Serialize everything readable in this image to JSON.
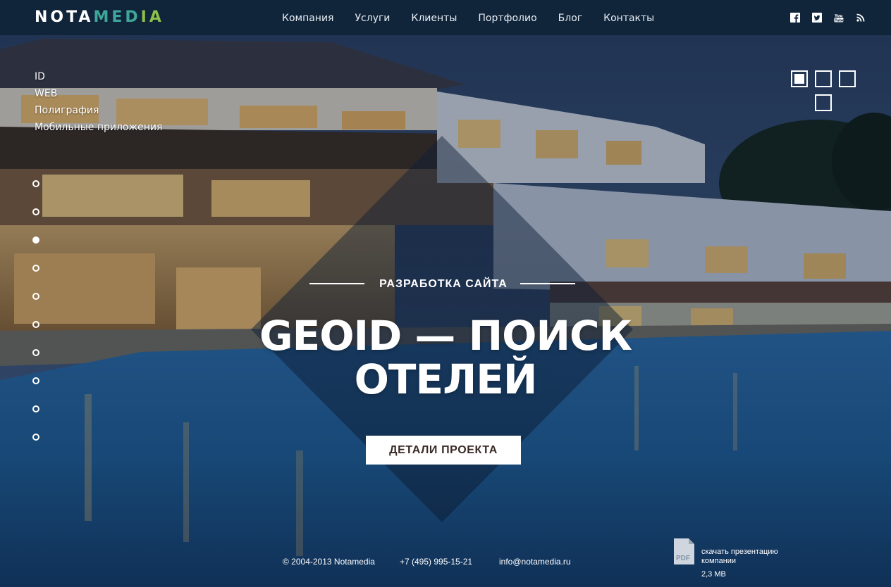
{
  "header": {
    "logo": {
      "part1": "NOTA",
      "part2_a": "MED",
      "part2_b": "IA"
    },
    "nav": [
      {
        "label": "Компания"
      },
      {
        "label": "Услуги"
      },
      {
        "label": "Клиенты"
      },
      {
        "label": "Портфолио"
      },
      {
        "label": "Блог"
      },
      {
        "label": "Контакты"
      }
    ],
    "social": [
      "facebook-icon",
      "twitter-icon",
      "youtube-icon",
      "rss-icon"
    ]
  },
  "categories": [
    {
      "label": "ID"
    },
    {
      "label": "WEB"
    },
    {
      "label": "Полиграфия"
    },
    {
      "label": "Мобильные приложения"
    }
  ],
  "slider": {
    "total_dots": 10,
    "active_dot": 3
  },
  "view_switch": {
    "active": 1,
    "count": 4
  },
  "hero": {
    "eyebrow": "РАЗРАБОТКА САЙТА",
    "title_line1": "GEOID — ПОИСК",
    "title_line2": "ОТЕЛЕЙ",
    "cta": "ДЕТАЛИ ПРОЕКТА"
  },
  "footer": {
    "copyright": "© 2004-2013 Notamedia",
    "phone": "+7 (495) 995-15-21",
    "email": "info@notamedia.ru",
    "pdf_icon_label": "PDF",
    "pdf_text_line1": "скачать презентацию",
    "pdf_text_line2": "компании",
    "pdf_size": "2,3 MB"
  },
  "colors": {
    "header_bg": "#10243a",
    "logo_teal": "#3fa69a",
    "logo_green": "#8bc04a",
    "cta_text": "#3a2a25",
    "pool_blue": "#1f5a8e"
  }
}
